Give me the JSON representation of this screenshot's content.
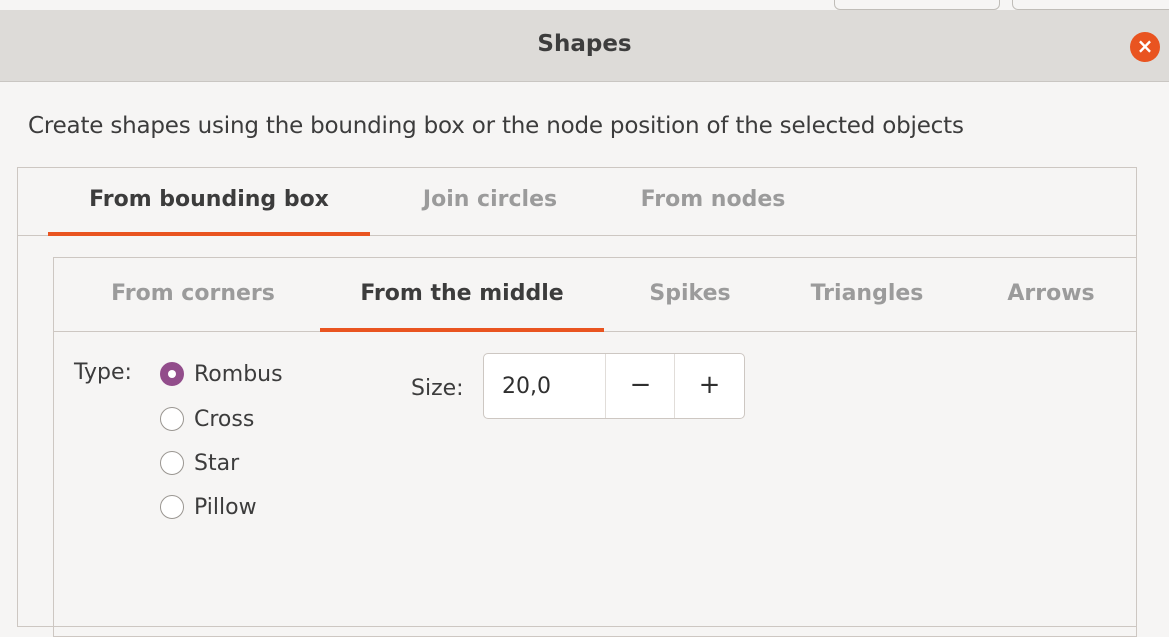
{
  "dialog": {
    "title": "Shapes",
    "close_icon": "close-icon",
    "description": "Create shapes using the bounding box or the node position of the selected objects"
  },
  "outer_tabs": [
    {
      "label": "From bounding box",
      "active": true
    },
    {
      "label": "Join circles",
      "active": false
    },
    {
      "label": "From nodes",
      "active": false
    }
  ],
  "inner_tabs": [
    {
      "label": "From corners",
      "active": false
    },
    {
      "label": "From the middle",
      "active": true
    },
    {
      "label": "Spikes",
      "active": false
    },
    {
      "label": "Triangles",
      "active": false
    },
    {
      "label": "Arrows",
      "active": false
    }
  ],
  "type": {
    "label": "Type:",
    "options": [
      {
        "label": "Rombus",
        "checked": true
      },
      {
        "label": "Cross",
        "checked": false
      },
      {
        "label": "Star",
        "checked": false
      },
      {
        "label": "Pillow",
        "checked": false
      }
    ]
  },
  "size": {
    "label": "Size:",
    "value": "20,0",
    "decrement": "−",
    "increment": "+"
  },
  "colors": {
    "accent": "#e95420",
    "radio_checked": "#924d8b",
    "titlebar": "#dddbd8",
    "background": "#f6f5f4"
  }
}
